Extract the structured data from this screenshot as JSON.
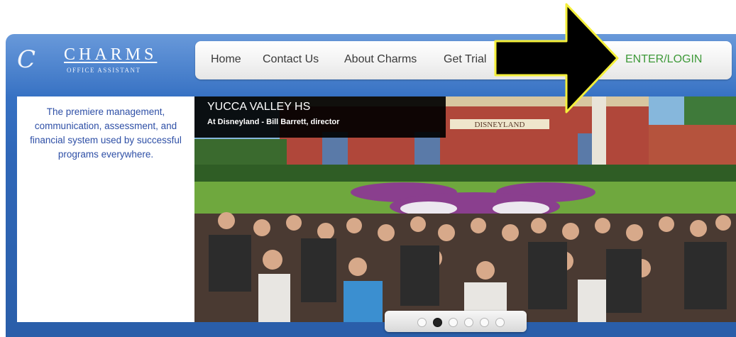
{
  "logo": {
    "mark": "C",
    "name": "CHARMS",
    "subtitle": "OFFICE ASSISTANT"
  },
  "nav": {
    "items": [
      "Home",
      "Contact Us",
      "About Charms",
      "Get Trial"
    ],
    "login": "ENTER/LOGIN"
  },
  "tagline": "The premiere management, communication, assessment, and financial system used by successful programs everywhere.",
  "slideshow": {
    "title": "YUCCA VALLEY HS",
    "subtitle": "At Disneyland - Bill Barrett, director",
    "sign": "DISNEYLAND",
    "slide_count": 6,
    "active_slide": 2
  },
  "colors": {
    "brand_blue": "#2f67b8",
    "tagline_text": "#2e4fa6",
    "login_green": "#3f9a3a",
    "arrow": "#000000",
    "arrow_outline": "#f4ef3a"
  },
  "icons": {
    "arrow": "arrow-right-icon"
  }
}
